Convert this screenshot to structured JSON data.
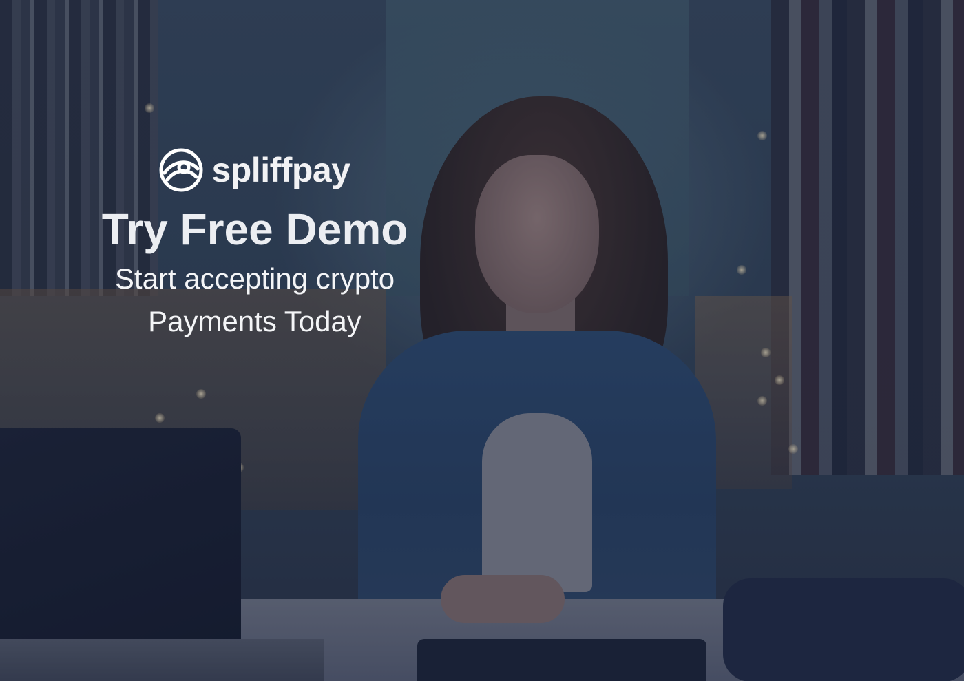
{
  "brand": {
    "name": "spliffpay",
    "logo_icon": "spiral-globe-icon"
  },
  "hero": {
    "headline": "Try Free Demo",
    "subline_1": "Start accepting crypto",
    "subline_2": "Payments Today"
  },
  "colors": {
    "overlay": "#141c37",
    "text": "#ffffff"
  }
}
